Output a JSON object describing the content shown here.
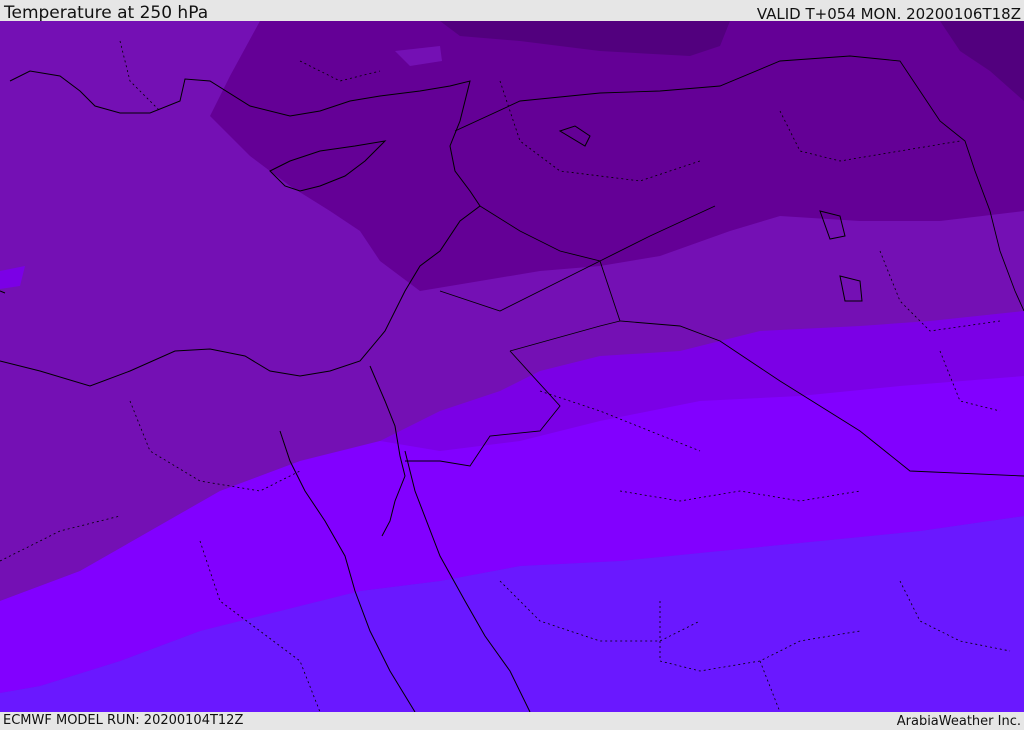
{
  "header": {
    "title": "Temperature at 250 hPa",
    "valid": "VALID T+054 MON. 20200106T18Z"
  },
  "footer": {
    "model_run": "ECMWF MODEL RUN: 20200104T12Z",
    "credit": "ArabiaWeather Inc."
  },
  "colors": {
    "band_darkest": "#52007e",
    "band_dark": "#640096",
    "band_mid": "#7410b4",
    "band_violet": "#7b00e6",
    "band_bright": "#8200ff",
    "band_blue": "#6a18ff",
    "coastline": "#000000"
  }
}
